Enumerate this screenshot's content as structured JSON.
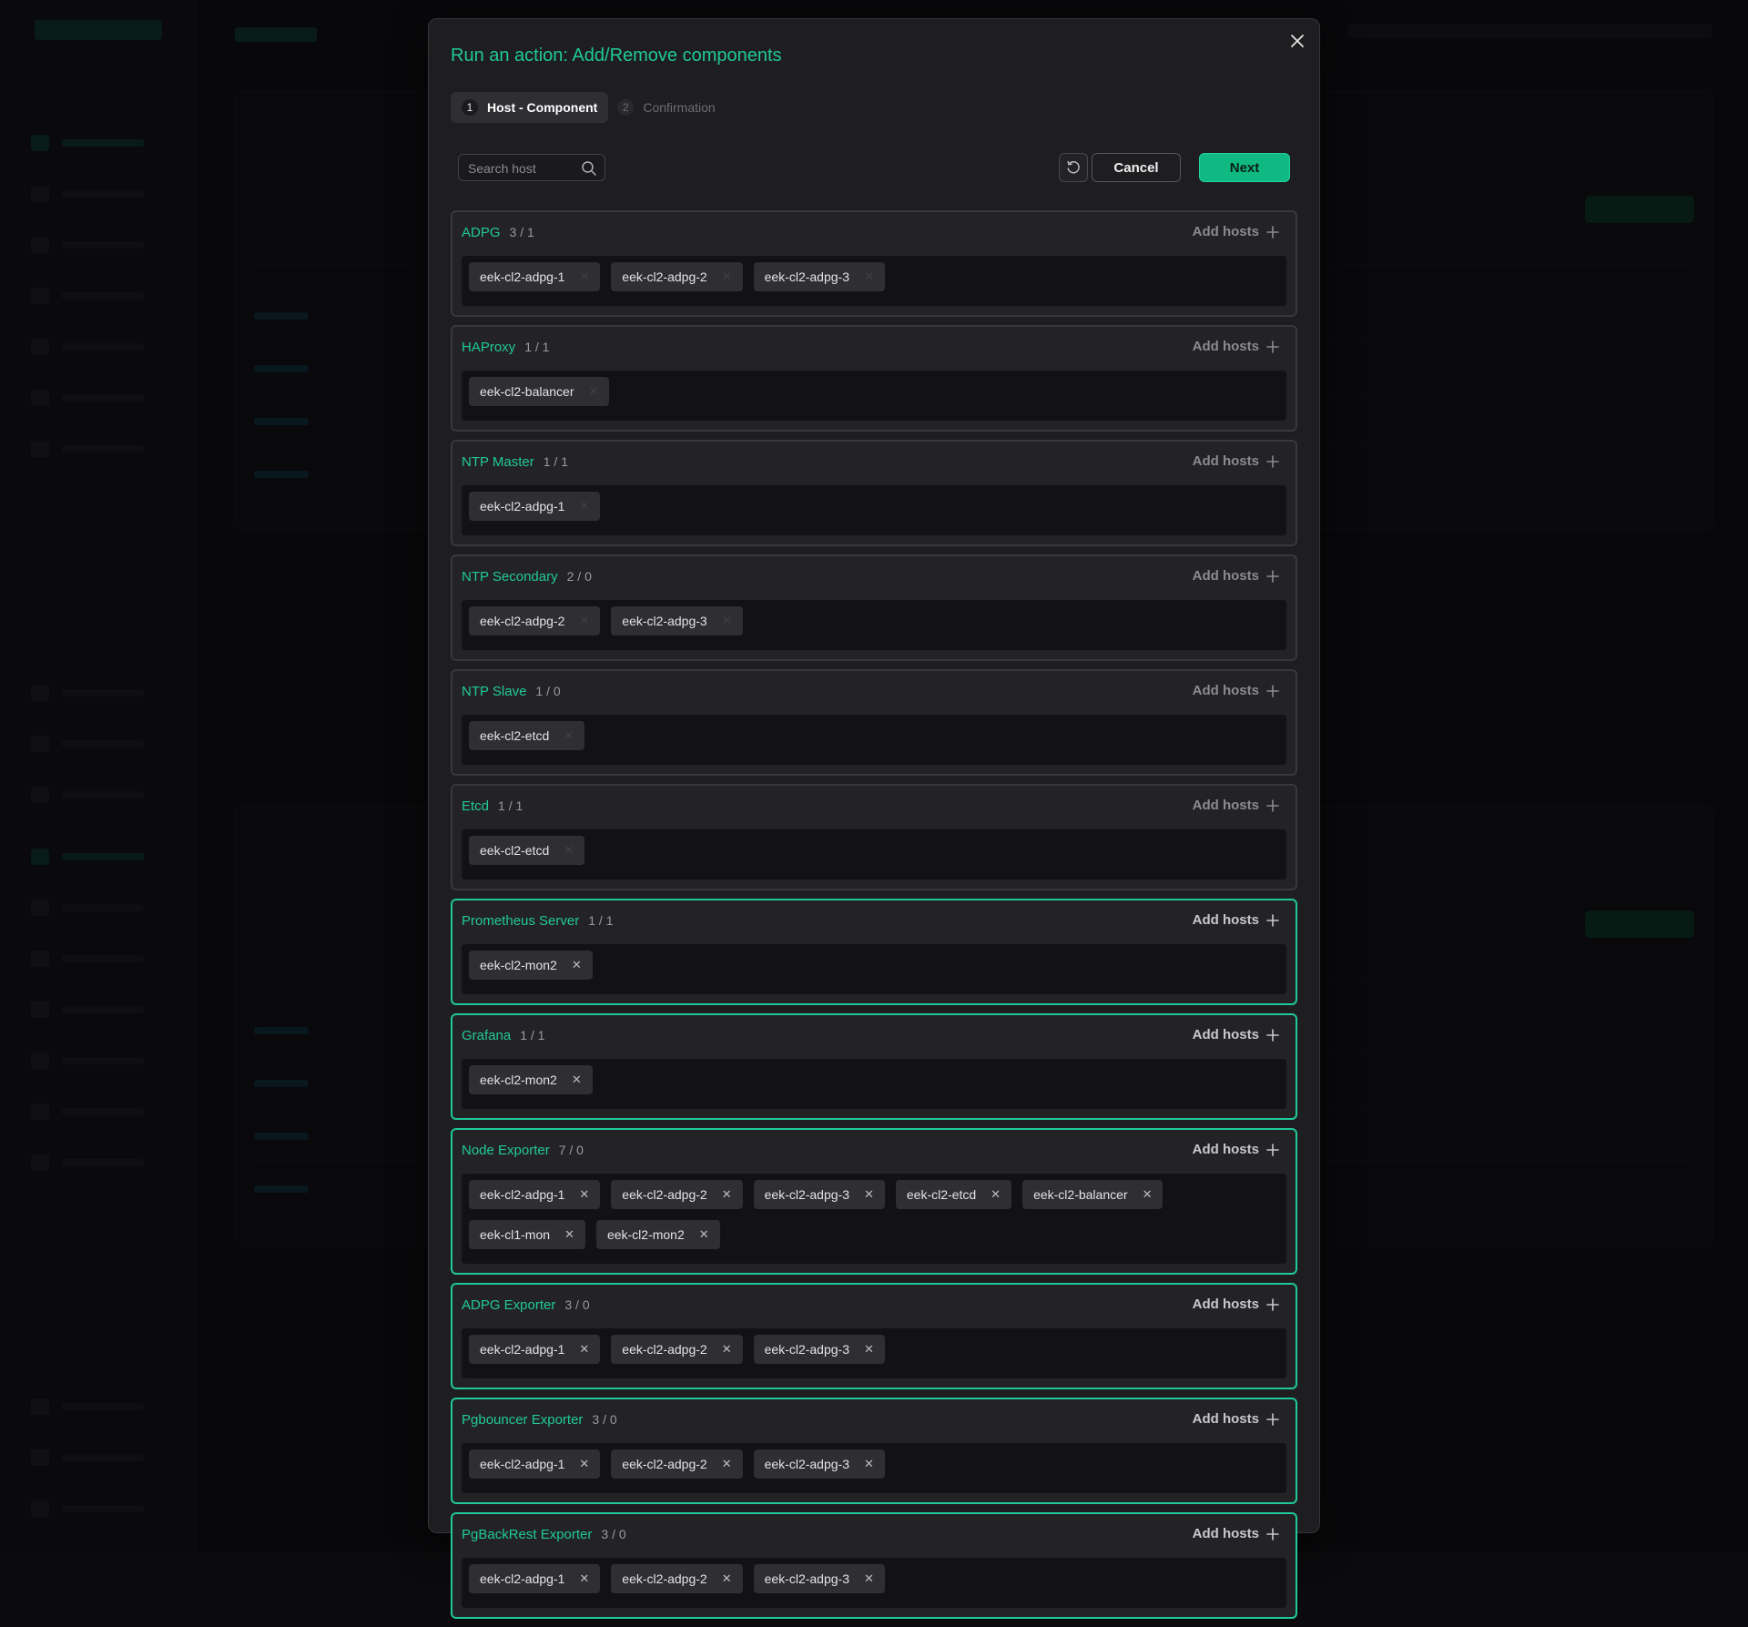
{
  "modal": {
    "title": "Run an action: Add/Remove components",
    "steps": [
      {
        "num": "1",
        "label": "Host - Component",
        "active": true
      },
      {
        "num": "2",
        "label": "Confirmation",
        "active": false
      }
    ],
    "search": {
      "placeholder": "Search host",
      "value": ""
    },
    "cancel_label": "Cancel",
    "next_label": "Next",
    "add_hosts_label": "Add hosts",
    "components": [
      {
        "name": "ADPG",
        "count": "3 / 1",
        "highlighted": false,
        "hosts": [
          "eek-cl2-adpg-1",
          "eek-cl2-adpg-2",
          "eek-cl2-adpg-3"
        ]
      },
      {
        "name": "HAProxy",
        "count": "1 / 1",
        "highlighted": false,
        "hosts": [
          "eek-cl2-balancer"
        ]
      },
      {
        "name": "NTP Master",
        "count": "1 / 1",
        "highlighted": false,
        "hosts": [
          "eek-cl2-adpg-1"
        ]
      },
      {
        "name": "NTP Secondary",
        "count": "2 / 0",
        "highlighted": false,
        "hosts": [
          "eek-cl2-adpg-2",
          "eek-cl2-adpg-3"
        ]
      },
      {
        "name": "NTP Slave",
        "count": "1 / 0",
        "highlighted": false,
        "hosts": [
          "eek-cl2-etcd"
        ]
      },
      {
        "name": "Etcd",
        "count": "1 / 1",
        "highlighted": false,
        "hosts": [
          "eek-cl2-etcd"
        ]
      },
      {
        "name": "Prometheus Server",
        "count": "1 / 1",
        "highlighted": true,
        "hosts": [
          "eek-cl2-mon2"
        ]
      },
      {
        "name": "Grafana",
        "count": "1 / 1",
        "highlighted": true,
        "hosts": [
          "eek-cl2-mon2"
        ]
      },
      {
        "name": "Node Exporter",
        "count": "7 / 0",
        "highlighted": true,
        "hosts": [
          "eek-cl2-adpg-1",
          "eek-cl2-adpg-2",
          "eek-cl2-adpg-3",
          "eek-cl2-etcd",
          "eek-cl2-balancer",
          "eek-cl1-mon",
          "eek-cl2-mon2"
        ]
      },
      {
        "name": "ADPG Exporter",
        "count": "3 / 0",
        "highlighted": true,
        "hosts": [
          "eek-cl2-adpg-1",
          "eek-cl2-adpg-2",
          "eek-cl2-adpg-3"
        ]
      },
      {
        "name": "Pgbouncer Exporter",
        "count": "3 / 0",
        "highlighted": true,
        "hosts": [
          "eek-cl2-adpg-1",
          "eek-cl2-adpg-2",
          "eek-cl2-adpg-3"
        ]
      },
      {
        "name": "PgBackRest Exporter",
        "count": "3 / 0",
        "highlighted": true,
        "hosts": [
          "eek-cl2-adpg-1",
          "eek-cl2-adpg-2",
          "eek-cl2-adpg-3"
        ]
      }
    ]
  },
  "icons": {
    "close": "close-icon",
    "search": "search-icon",
    "reset": "refresh-icon",
    "add": "plus-icon",
    "remove_chip": "close-small-icon"
  },
  "colors": {
    "accent": "#20c997",
    "next_button": "#10b981",
    "highlight_border": "#1ec99a",
    "modal_bg": "#1e1e21"
  }
}
